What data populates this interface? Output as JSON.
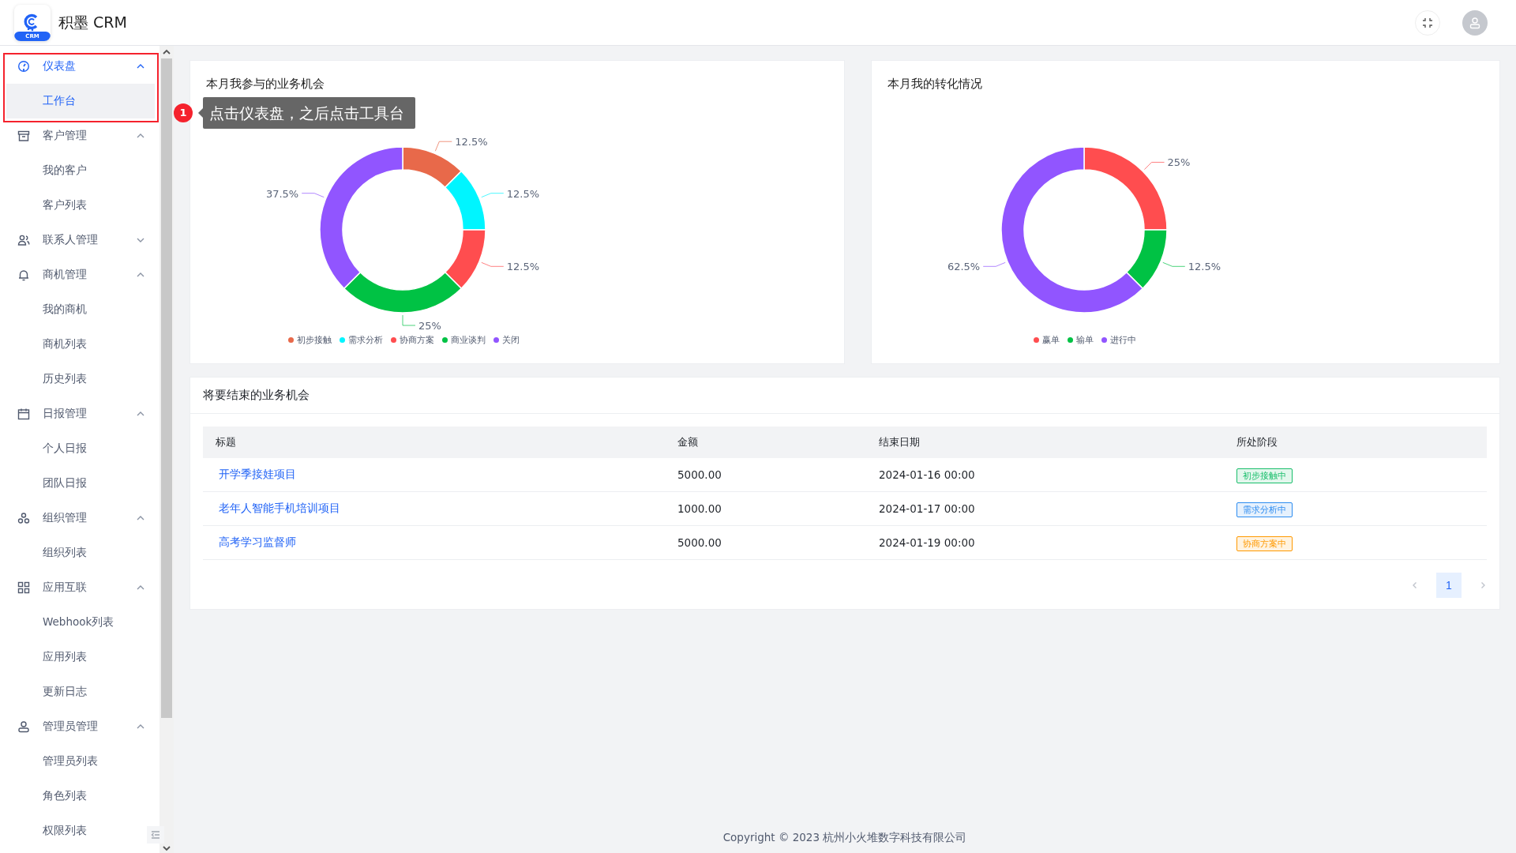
{
  "header": {
    "app_name": "积墨 CRM",
    "logo_badge": "CRM"
  },
  "sidebar": {
    "items": [
      {
        "label": "仪表盘",
        "kind": "dashboard",
        "active": true,
        "expanded": true,
        "children": [
          {
            "label": "工作台",
            "selected": true
          }
        ]
      },
      {
        "label": "客户管理",
        "kind": "archive",
        "active": false,
        "expanded": true,
        "children": [
          {
            "label": "我的客户",
            "selected": false
          },
          {
            "label": "客户列表",
            "selected": false
          }
        ]
      },
      {
        "label": "联系人管理",
        "kind": "people",
        "active": false,
        "expanded": false
      },
      {
        "label": "商机管理",
        "kind": "bell",
        "active": false,
        "expanded": true,
        "children": [
          {
            "label": "我的商机",
            "selected": false
          },
          {
            "label": "商机列表",
            "selected": false
          },
          {
            "label": "历史列表",
            "selected": false
          }
        ]
      },
      {
        "label": "日报管理",
        "kind": "calendar",
        "active": false,
        "expanded": true,
        "children": [
          {
            "label": "个人日报",
            "selected": false
          },
          {
            "label": "团队日报",
            "selected": false
          }
        ]
      },
      {
        "label": "组织管理",
        "kind": "org",
        "active": false,
        "expanded": true,
        "children": [
          {
            "label": "组织列表",
            "selected": false
          }
        ]
      },
      {
        "label": "应用互联",
        "kind": "grid",
        "active": false,
        "expanded": true,
        "children": [
          {
            "label": "Webhook列表",
            "selected": false
          },
          {
            "label": "应用列表",
            "selected": false
          },
          {
            "label": "更新日志",
            "selected": false
          }
        ]
      },
      {
        "label": "管理员管理",
        "kind": "user",
        "active": false,
        "expanded": true,
        "children": [
          {
            "label": "管理员列表",
            "selected": false
          },
          {
            "label": "角色列表",
            "selected": false
          },
          {
            "label": "权限列表",
            "selected": false
          }
        ]
      }
    ]
  },
  "guide": {
    "step": "1",
    "text": "点击仪表盘，之后点击工具台"
  },
  "charts": [
    {
      "title": "本月我参与的业务机会",
      "chart_data": {
        "type": "donut",
        "categories": [
          "初步接触",
          "需求分析",
          "协商方案",
          "商业谈判",
          "关闭"
        ],
        "values": [
          12.5,
          12.5,
          12.5,
          25,
          37.5
        ],
        "legend": true,
        "colors": [
          "#e8694a",
          "#00f5ff",
          "#ff4d4f",
          "#00c244",
          "#9155ff"
        ],
        "value_labels": [
          "12.5%",
          "12.5%",
          "12.5%",
          "25%",
          "37.5%"
        ]
      }
    },
    {
      "title": "本月我的转化情况",
      "chart_data": {
        "type": "donut",
        "categories": [
          "赢单",
          "输单",
          "进行中"
        ],
        "values": [
          25,
          12.5,
          62.5
        ],
        "legend": true,
        "colors": [
          "#ff4d4f",
          "#00c244",
          "#9155ff"
        ],
        "value_labels": [
          "25%",
          "12.5%",
          "62.5%"
        ]
      }
    }
  ],
  "table": {
    "title": "将要结束的业务机会",
    "columns": [
      "标题",
      "金额",
      "结束日期",
      "所处阶段"
    ],
    "rows": [
      {
        "title": "开学季接娃项目",
        "amount": "5000.00",
        "end_date": "2024-01-16 00:00",
        "stage": {
          "label": "初步接触中",
          "color": "#19be6b"
        }
      },
      {
        "title": "老年人智能手机培训项目",
        "amount": "1000.00",
        "end_date": "2024-01-17 00:00",
        "stage": {
          "label": "需求分析中",
          "color": "#2d8cf0"
        }
      },
      {
        "title": "高考学习监督师",
        "amount": "5000.00",
        "end_date": "2024-01-19 00:00",
        "stage": {
          "label": "协商方案中",
          "color": "#ff9900"
        }
      }
    ],
    "pages": [
      {
        "label": "1",
        "selected": true
      }
    ]
  },
  "footer": "Copyright © 2023 杭州小火堆数字科技有限公司"
}
